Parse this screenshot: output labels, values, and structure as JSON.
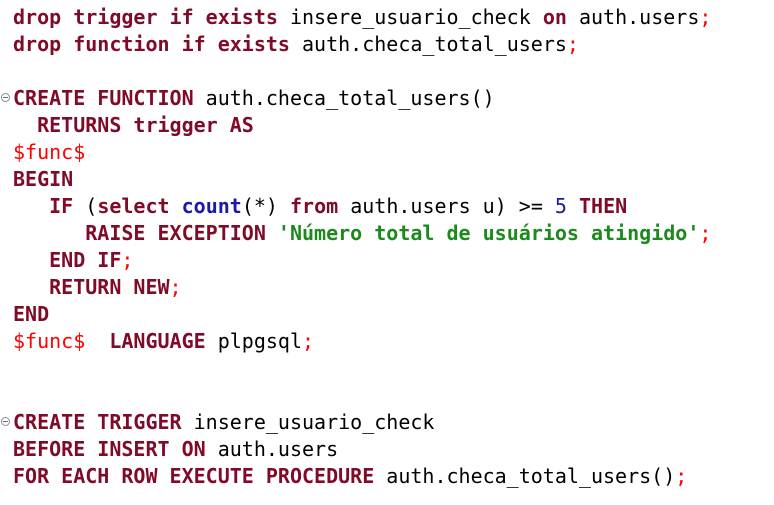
{
  "lines": [
    [
      {
        "t": "drop trigger if exists",
        "s": "kw"
      },
      {
        "t": " insere_usuario_check ",
        "s": "id"
      },
      {
        "t": "on",
        "s": "kw"
      },
      {
        "t": " auth.users",
        "s": "id"
      },
      {
        "t": ";",
        "s": "pn"
      }
    ],
    [
      {
        "t": "drop function if exists",
        "s": "kw"
      },
      {
        "t": " auth.checa_total_users",
        "s": "id"
      },
      {
        "t": ";",
        "s": "pn"
      }
    ],
    [],
    [
      {
        "t": "CREATE FUNCTION",
        "s": "kw"
      },
      {
        "t": " auth.checa_total_users()",
        "s": "id"
      }
    ],
    [
      {
        "t": "  ",
        "s": "id"
      },
      {
        "t": "RETURNS trigger AS",
        "s": "kw"
      }
    ],
    [
      {
        "t": "$func$",
        "s": "pn"
      }
    ],
    [
      {
        "t": "BEGIN",
        "s": "kw"
      }
    ],
    [
      {
        "t": "   ",
        "s": "id"
      },
      {
        "t": "IF",
        "s": "kw"
      },
      {
        "t": " (",
        "s": "id"
      },
      {
        "t": "select",
        "s": "kw"
      },
      {
        "t": " ",
        "s": "id"
      },
      {
        "t": "count",
        "s": "kb"
      },
      {
        "t": "(*) ",
        "s": "id"
      },
      {
        "t": "from",
        "s": "kw"
      },
      {
        "t": " auth.users u) >= ",
        "s": "id"
      },
      {
        "t": "5",
        "s": "num"
      },
      {
        "t": " ",
        "s": "id"
      },
      {
        "t": "THEN",
        "s": "kw"
      }
    ],
    [
      {
        "t": "      ",
        "s": "id"
      },
      {
        "t": "RAISE EXCEPTION",
        "s": "kw"
      },
      {
        "t": " ",
        "s": "id"
      },
      {
        "t": "'Número total de usuários atingido'",
        "s": "str"
      },
      {
        "t": ";",
        "s": "pn"
      }
    ],
    [
      {
        "t": "   ",
        "s": "id"
      },
      {
        "t": "END IF",
        "s": "kw"
      },
      {
        "t": ";",
        "s": "pn"
      }
    ],
    [
      {
        "t": "   ",
        "s": "id"
      },
      {
        "t": "RETURN NEW",
        "s": "kw"
      },
      {
        "t": ";",
        "s": "pn"
      }
    ],
    [
      {
        "t": "END",
        "s": "kw"
      }
    ],
    [
      {
        "t": "$func$",
        "s": "pn"
      },
      {
        "t": "  ",
        "s": "id"
      },
      {
        "t": "LANGUAGE",
        "s": "kw"
      },
      {
        "t": " plpgsql",
        "s": "id"
      },
      {
        "t": ";",
        "s": "pn"
      }
    ],
    [],
    [],
    [
      {
        "t": "CREATE TRIGGER",
        "s": "kw"
      },
      {
        "t": " insere_usuario_check",
        "s": "id"
      }
    ],
    [
      {
        "t": "BEFORE INSERT ON",
        "s": "kw"
      },
      {
        "t": " auth.users",
        "s": "id"
      }
    ],
    [
      {
        "t": "FOR EACH ROW EXECUTE PROCEDURE",
        "s": "kw"
      },
      {
        "t": " auth.checa_total_users()",
        "s": "id"
      },
      {
        "t": ";",
        "s": "pn"
      }
    ]
  ],
  "fold_markers": [
    3,
    15
  ],
  "colors": {
    "keyword": "#7f0b28",
    "builtin": "#1e1aa8",
    "string": "#1e8a1e",
    "punctuation": "#ff0000",
    "number": "#1e1aa8",
    "text": "#000000",
    "background": "#ffffff"
  },
  "icons": {
    "fold": "collapse-icon"
  }
}
